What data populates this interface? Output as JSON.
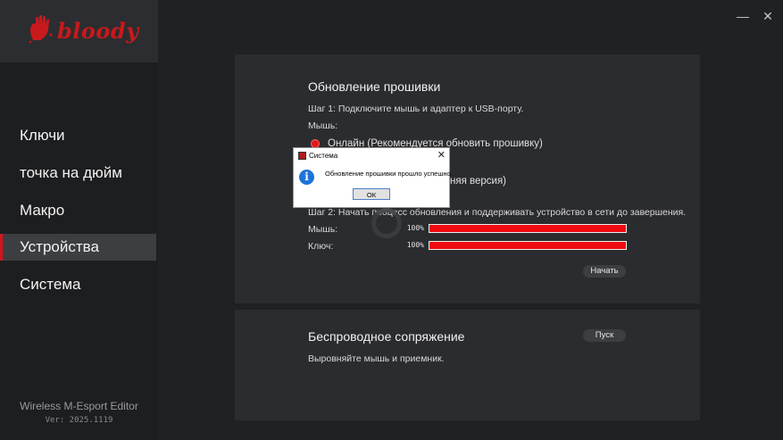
{
  "app": {
    "brand": "bloody",
    "name": "Wireless M-Esport Editor",
    "version": "Ver: 2025.1119"
  },
  "window": {
    "minimize": "—",
    "close": "✕"
  },
  "sidebar": {
    "items": [
      {
        "label": "Ключи"
      },
      {
        "label": "точка на дюйм"
      },
      {
        "label": "Макро"
      },
      {
        "label": "Устройства",
        "active": true
      },
      {
        "label": "Система"
      }
    ]
  },
  "firmware": {
    "title": "Обновление прошивки",
    "step1": "Шаг 1: Подключите мышь и адаптер к USB-порту.",
    "mouse_label": "Мышь:",
    "option_online": "Онлайн (Рекомендуется обновить прошивку)",
    "option_local_visible": "няя версия)",
    "step2": "Шаг 2: Начать процесс обновления и поддерживать устройство в сети до завершения.",
    "progress": [
      {
        "label": "Мышь:",
        "percent_text": "100%",
        "value": 100
      },
      {
        "label": "Ключ:",
        "percent_text": "100%",
        "value": 100
      }
    ],
    "start_button": "Начать"
  },
  "pairing": {
    "title": "Беспроводное сопряжение",
    "description": "Выровняйте мышь и приемник.",
    "start_button": "Пуск"
  },
  "dialog": {
    "title": "Система",
    "message": "Обновление прошивки прошло успешно.",
    "ok_button": "ОК",
    "icon": "info-icon"
  },
  "colors": {
    "accent": "#d4141b",
    "progress_fill": "#ee0a10",
    "info_blue": "#1e73d8"
  }
}
